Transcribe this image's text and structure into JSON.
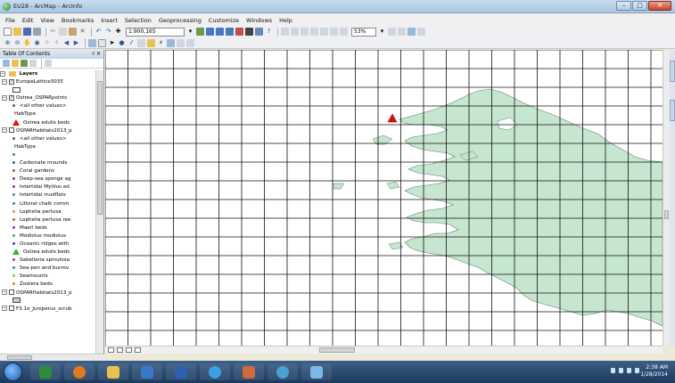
{
  "window": {
    "title": "EU28 - ArcMap - ArcInfo",
    "buttons": [
      "–",
      "□",
      "✕"
    ]
  },
  "menu": [
    "File",
    "Edit",
    "View",
    "Bookmarks",
    "Insert",
    "Selection",
    "Geoprocessing",
    "Customize",
    "Windows",
    "Help"
  ],
  "toolbar": {
    "scale": "1:900,165",
    "zoom_percent": "53%"
  },
  "toc": {
    "title": "Table Of Contents",
    "pin": "♯ ✕",
    "layers_label": "Layers",
    "rows": [
      {
        "kind": "layer",
        "label": "EuropeLattice3035",
        "checked": true,
        "expanded": true
      },
      {
        "kind": "swatch",
        "label": ""
      },
      {
        "kind": "layer",
        "label": "Ostrea_OSPARpoints",
        "checked": true,
        "expanded": true
      },
      {
        "kind": "dot",
        "label": "<all other values>",
        "color": "#2b6aa0"
      },
      {
        "kind": "text",
        "label": "HabType"
      },
      {
        "kind": "tri",
        "label": "Ostrea edulis beds",
        "color": "#e01010"
      },
      {
        "kind": "layer",
        "label": "OSPARHabitats2013_p",
        "checked": false,
        "expanded": true
      },
      {
        "kind": "dot",
        "label": "<all other values>",
        "color": "#2b6aa0"
      },
      {
        "kind": "text",
        "label": "HabType"
      },
      {
        "kind": "dot",
        "label": "",
        "color": "#2f9e44"
      },
      {
        "kind": "dot",
        "label": "Carbonate mounds",
        "color": "#2b6aa0"
      },
      {
        "kind": "dot",
        "label": "Coral gardens",
        "color": "#a05a2b"
      },
      {
        "kind": "dot",
        "label": "Deep-sea sponge ag",
        "color": "#7a3fa0"
      },
      {
        "kind": "dot",
        "label": "Intertidal Mytilus ed",
        "color": "#b0306a"
      },
      {
        "kind": "dot",
        "label": "Intertidal mudflats",
        "color": "#2b9aa0"
      },
      {
        "kind": "dot",
        "label": "Littoral chalk comm",
        "color": "#4a70c4"
      },
      {
        "kind": "dot",
        "label": "Lophelia pertusa",
        "color": "#c4a02b"
      },
      {
        "kind": "dot",
        "label": "Lophelia pertusa ree",
        "color": "#c45a2b"
      },
      {
        "kind": "dot",
        "label": "Maerl beds",
        "color": "#8a2bc4"
      },
      {
        "kind": "dot",
        "label": "Modiolus modiolus",
        "color": "#2bc46a"
      },
      {
        "kind": "dot",
        "label": "Oceanic ridges with",
        "color": "#2b4ac4"
      },
      {
        "kind": "tri",
        "label": "Ostrea edulis beds",
        "color": "#2fb82f"
      },
      {
        "kind": "dot",
        "label": "Sabellaria spinulosa",
        "color": "#c42b8a"
      },
      {
        "kind": "dot",
        "label": "Sea-pen and burrov",
        "color": "#2b8ac4"
      },
      {
        "kind": "dot",
        "label": "Seamounts",
        "color": "#8ac42b"
      },
      {
        "kind": "dot",
        "label": "Zostera beds",
        "color": "#c48a2b"
      },
      {
        "kind": "layer",
        "label": "OSPARHabitats2013_p",
        "checked": false,
        "expanded": true
      },
      {
        "kind": "swatch",
        "label": "",
        "color": "#b8e0b8"
      },
      {
        "kind": "layer",
        "label": "F3.1e_Juniperus_scrub",
        "checked": false,
        "expanded": true
      }
    ]
  },
  "map": {
    "land_color": "#c7e6d0",
    "grid_color": "#111111",
    "point_color": "#e01010"
  },
  "taskbar": {
    "time": "2:38 AM",
    "date": "1/28/2014"
  }
}
